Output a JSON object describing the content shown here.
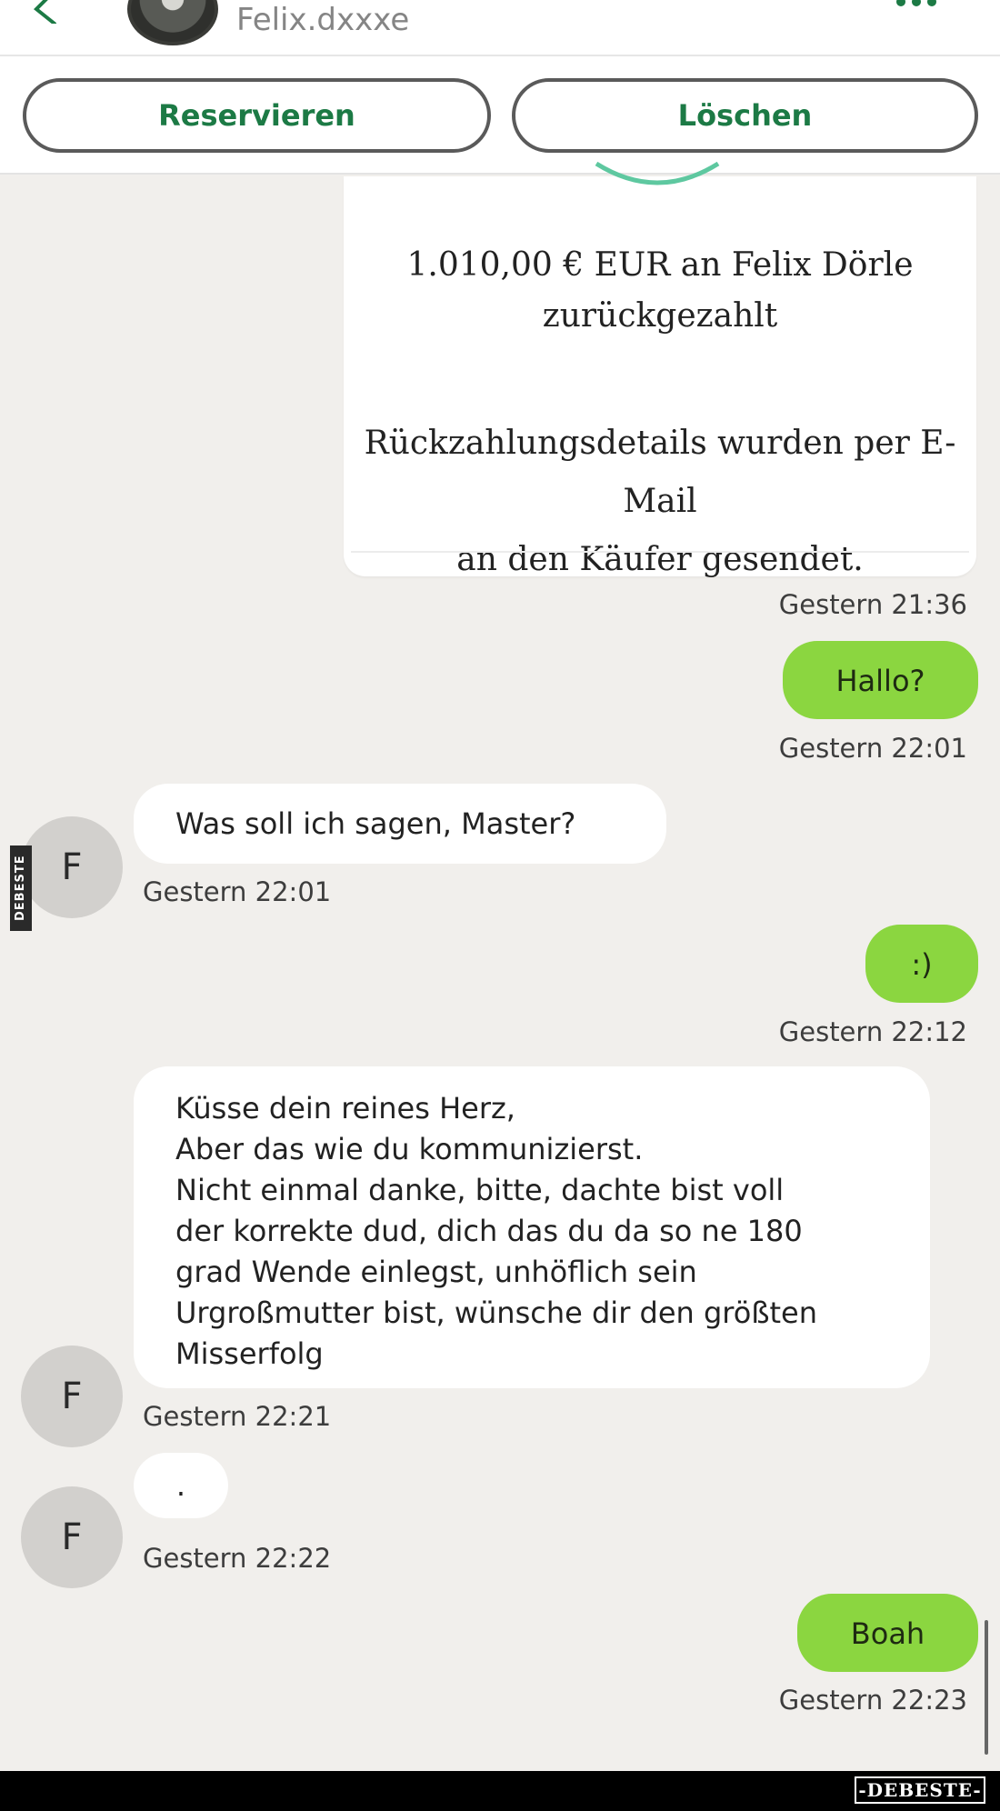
{
  "header": {
    "username": "Felix.dxxxe",
    "icons": {
      "back": "chevron-left-icon",
      "more": "more-dots-icon"
    }
  },
  "actions": {
    "reserve_label": "Reservieren",
    "delete_label": "Löschen"
  },
  "refund_card": {
    "line1": "1.010,00 € EUR an Felix Dörle\nzurückgezahlt",
    "line2": "Rückzahlungsdetails wurden per E-Mail\nan den Käufer gesendet.",
    "time": "Gestern 21:36"
  },
  "messages": [
    {
      "direction": "out",
      "text": "Hallo?",
      "time": "Gestern 22:01"
    },
    {
      "direction": "in",
      "avatar": "F",
      "text": "Was soll ich sagen, Master?",
      "time": "Gestern 22:01"
    },
    {
      "direction": "out",
      "text": ":)",
      "time": "Gestern 22:12"
    },
    {
      "direction": "in",
      "avatar": "F",
      "text": "Küsse dein reines Herz,\nAber das wie du kommunizierst.\nNicht einmal danke, bitte, dachte bist voll\nder korrekte dud, dich das du da so ne 180\ngrad Wende einlegst, unhöflich sein\nUrgroßmutter bist, wünsche dir den größten\nMisserfolg",
      "time": "Gestern 22:21"
    },
    {
      "direction": "in",
      "avatar": "F",
      "text": ".",
      "time": "Gestern 22:22"
    },
    {
      "direction": "out",
      "text": "Boah",
      "time": "Gestern 22:23"
    }
  ],
  "watermark": {
    "side": "DEBESTE",
    "bottom": "-DEBESTE-"
  },
  "colors": {
    "accent_green": "#8bd640",
    "button_text": "#1c7a45",
    "chat_bg": "#f1efec"
  }
}
